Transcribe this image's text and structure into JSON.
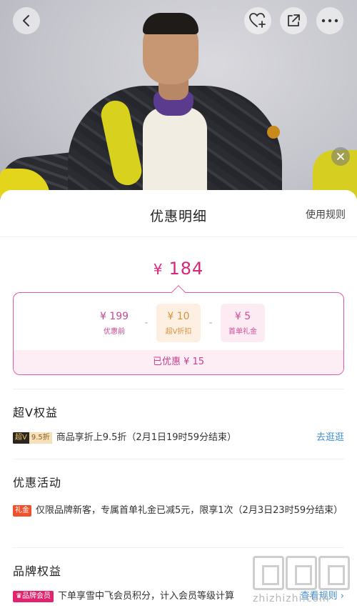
{
  "hero": {
    "icons": [
      "back-icon",
      "heart-plus-icon",
      "share-icon",
      "more-icon",
      "close-icon"
    ]
  },
  "sheet": {
    "title": "优惠明细",
    "rules_link": "使用规则",
    "final_price": {
      "currency": "¥",
      "amount": "184"
    },
    "calc": {
      "pre_discount": {
        "amount": "¥ 199",
        "label": "优惠前"
      },
      "op1": "-",
      "svip_discount": {
        "amount": "¥ 10",
        "label": "超V折扣"
      },
      "op2": "-",
      "first_order_gift": {
        "amount": "¥ 5",
        "label": "首单礼金"
      },
      "saved": "已优惠  ¥ 15"
    },
    "svip": {
      "title": "超V权益",
      "badge_a": "超V",
      "badge_b": "9.5折",
      "text": "商品享折上9.5折（2月1日19时59分结束）",
      "link": "去逛逛"
    },
    "promo": {
      "title": "优惠活动",
      "badge": "礼金",
      "text": "仅限品牌新客，专属首单礼金已减5元，限享1次（2月3日23时59分结束）"
    },
    "brand": {
      "title": "品牌权益",
      "badge": "♛品牌会员",
      "text": "下单享雪中飞会员积分，计入会员等级计算",
      "link": "查看规则 ›"
    }
  },
  "watermark": {
    "text": "zhizhizhi.com"
  },
  "colors": {
    "accent": "#d6287a",
    "link": "#3e8fd6",
    "svip": "#d9913c"
  }
}
